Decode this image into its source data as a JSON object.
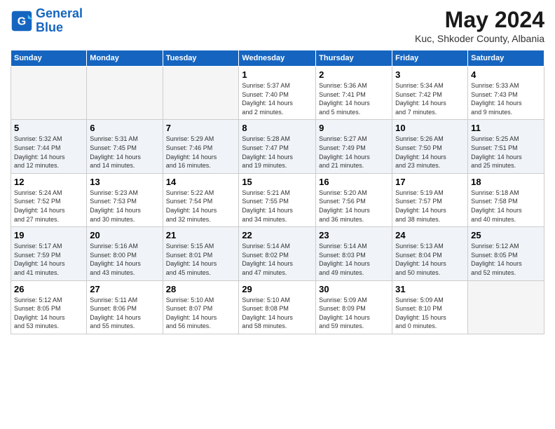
{
  "header": {
    "logo_line1": "General",
    "logo_line2": "Blue",
    "month": "May 2024",
    "location": "Kuc, Shkoder County, Albania"
  },
  "columns": [
    "Sunday",
    "Monday",
    "Tuesday",
    "Wednesday",
    "Thursday",
    "Friday",
    "Saturday"
  ],
  "weeks": [
    [
      {
        "day": "",
        "info": ""
      },
      {
        "day": "",
        "info": ""
      },
      {
        "day": "",
        "info": ""
      },
      {
        "day": "1",
        "info": "Sunrise: 5:37 AM\nSunset: 7:40 PM\nDaylight: 14 hours\nand 2 minutes."
      },
      {
        "day": "2",
        "info": "Sunrise: 5:36 AM\nSunset: 7:41 PM\nDaylight: 14 hours\nand 5 minutes."
      },
      {
        "day": "3",
        "info": "Sunrise: 5:34 AM\nSunset: 7:42 PM\nDaylight: 14 hours\nand 7 minutes."
      },
      {
        "day": "4",
        "info": "Sunrise: 5:33 AM\nSunset: 7:43 PM\nDaylight: 14 hours\nand 9 minutes."
      }
    ],
    [
      {
        "day": "5",
        "info": "Sunrise: 5:32 AM\nSunset: 7:44 PM\nDaylight: 14 hours\nand 12 minutes."
      },
      {
        "day": "6",
        "info": "Sunrise: 5:31 AM\nSunset: 7:45 PM\nDaylight: 14 hours\nand 14 minutes."
      },
      {
        "day": "7",
        "info": "Sunrise: 5:29 AM\nSunset: 7:46 PM\nDaylight: 14 hours\nand 16 minutes."
      },
      {
        "day": "8",
        "info": "Sunrise: 5:28 AM\nSunset: 7:47 PM\nDaylight: 14 hours\nand 19 minutes."
      },
      {
        "day": "9",
        "info": "Sunrise: 5:27 AM\nSunset: 7:49 PM\nDaylight: 14 hours\nand 21 minutes."
      },
      {
        "day": "10",
        "info": "Sunrise: 5:26 AM\nSunset: 7:50 PM\nDaylight: 14 hours\nand 23 minutes."
      },
      {
        "day": "11",
        "info": "Sunrise: 5:25 AM\nSunset: 7:51 PM\nDaylight: 14 hours\nand 25 minutes."
      }
    ],
    [
      {
        "day": "12",
        "info": "Sunrise: 5:24 AM\nSunset: 7:52 PM\nDaylight: 14 hours\nand 27 minutes."
      },
      {
        "day": "13",
        "info": "Sunrise: 5:23 AM\nSunset: 7:53 PM\nDaylight: 14 hours\nand 30 minutes."
      },
      {
        "day": "14",
        "info": "Sunrise: 5:22 AM\nSunset: 7:54 PM\nDaylight: 14 hours\nand 32 minutes."
      },
      {
        "day": "15",
        "info": "Sunrise: 5:21 AM\nSunset: 7:55 PM\nDaylight: 14 hours\nand 34 minutes."
      },
      {
        "day": "16",
        "info": "Sunrise: 5:20 AM\nSunset: 7:56 PM\nDaylight: 14 hours\nand 36 minutes."
      },
      {
        "day": "17",
        "info": "Sunrise: 5:19 AM\nSunset: 7:57 PM\nDaylight: 14 hours\nand 38 minutes."
      },
      {
        "day": "18",
        "info": "Sunrise: 5:18 AM\nSunset: 7:58 PM\nDaylight: 14 hours\nand 40 minutes."
      }
    ],
    [
      {
        "day": "19",
        "info": "Sunrise: 5:17 AM\nSunset: 7:59 PM\nDaylight: 14 hours\nand 41 minutes."
      },
      {
        "day": "20",
        "info": "Sunrise: 5:16 AM\nSunset: 8:00 PM\nDaylight: 14 hours\nand 43 minutes."
      },
      {
        "day": "21",
        "info": "Sunrise: 5:15 AM\nSunset: 8:01 PM\nDaylight: 14 hours\nand 45 minutes."
      },
      {
        "day": "22",
        "info": "Sunrise: 5:14 AM\nSunset: 8:02 PM\nDaylight: 14 hours\nand 47 minutes."
      },
      {
        "day": "23",
        "info": "Sunrise: 5:14 AM\nSunset: 8:03 PM\nDaylight: 14 hours\nand 49 minutes."
      },
      {
        "day": "24",
        "info": "Sunrise: 5:13 AM\nSunset: 8:04 PM\nDaylight: 14 hours\nand 50 minutes."
      },
      {
        "day": "25",
        "info": "Sunrise: 5:12 AM\nSunset: 8:05 PM\nDaylight: 14 hours\nand 52 minutes."
      }
    ],
    [
      {
        "day": "26",
        "info": "Sunrise: 5:12 AM\nSunset: 8:05 PM\nDaylight: 14 hours\nand 53 minutes."
      },
      {
        "day": "27",
        "info": "Sunrise: 5:11 AM\nSunset: 8:06 PM\nDaylight: 14 hours\nand 55 minutes."
      },
      {
        "day": "28",
        "info": "Sunrise: 5:10 AM\nSunset: 8:07 PM\nDaylight: 14 hours\nand 56 minutes."
      },
      {
        "day": "29",
        "info": "Sunrise: 5:10 AM\nSunset: 8:08 PM\nDaylight: 14 hours\nand 58 minutes."
      },
      {
        "day": "30",
        "info": "Sunrise: 5:09 AM\nSunset: 8:09 PM\nDaylight: 14 hours\nand 59 minutes."
      },
      {
        "day": "31",
        "info": "Sunrise: 5:09 AM\nSunset: 8:10 PM\nDaylight: 15 hours\nand 0 minutes."
      },
      {
        "day": "",
        "info": ""
      }
    ]
  ]
}
